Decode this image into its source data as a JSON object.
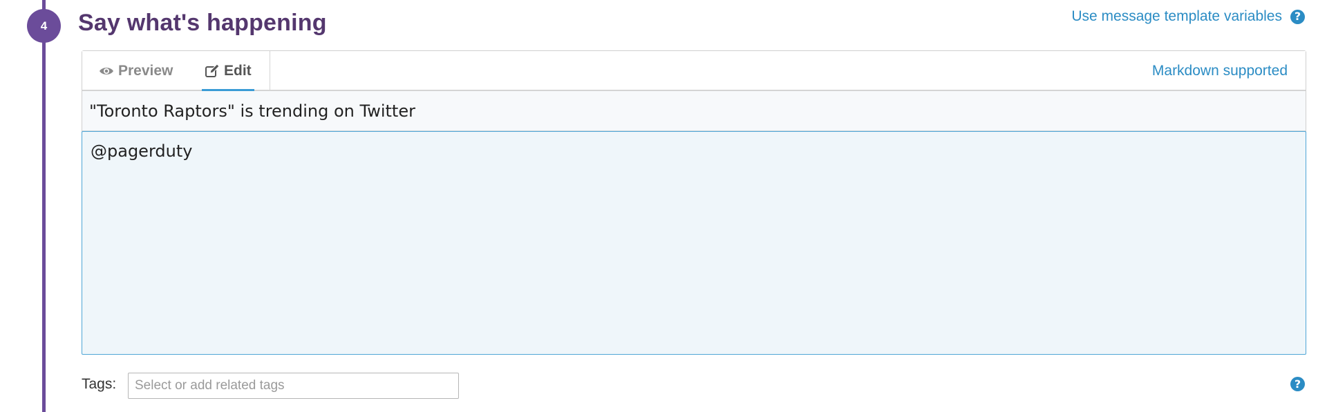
{
  "step": {
    "number": "4",
    "title": "Say what's happening"
  },
  "header": {
    "template_link": "Use message template variables",
    "help_icon": "question-circle-icon"
  },
  "editor": {
    "tabs": [
      {
        "label": "Preview",
        "icon": "eye-icon",
        "active": false
      },
      {
        "label": "Edit",
        "icon": "edit-icon",
        "active": true
      }
    ],
    "markdown_note": "Markdown supported",
    "title_value": "\"Toronto Raptors\" is trending on Twitter",
    "body_value": "@pagerduty"
  },
  "tags": {
    "label": "Tags:",
    "placeholder": "Select or add related tags",
    "help_icon": "question-circle-icon"
  },
  "colors": {
    "step_purple": "#6b4c9a",
    "title_purple": "#54376e",
    "link_blue": "#2b8cc4",
    "active_tab_underline": "#3a9bd6",
    "body_bg": "#eff6fa"
  }
}
